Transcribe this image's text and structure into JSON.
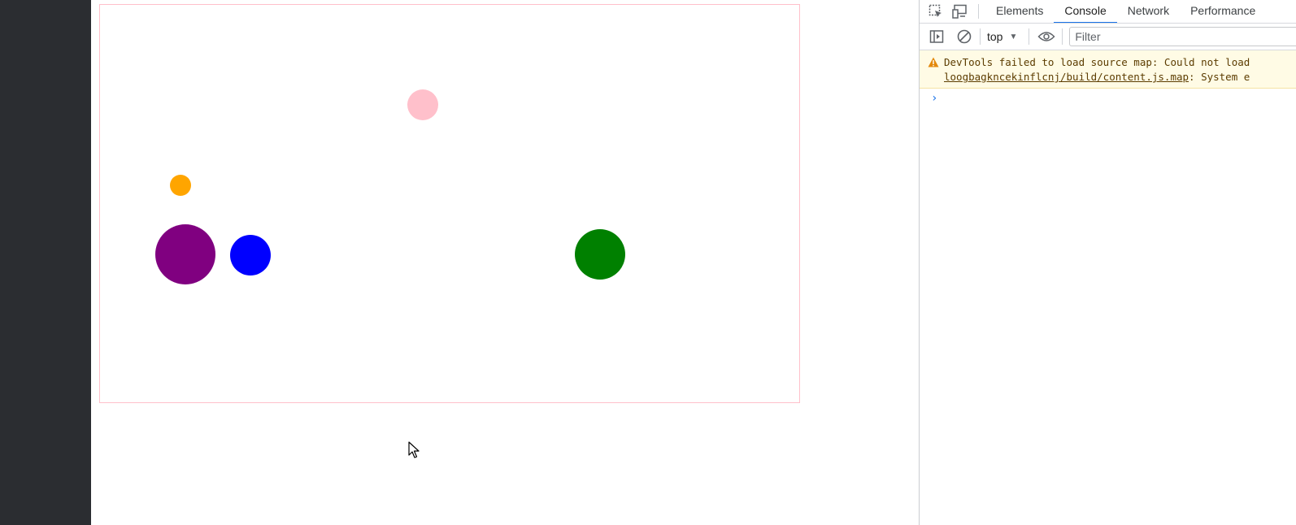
{
  "page": {
    "background": "#ffffff",
    "sidebar_color": "#2b2d31"
  },
  "canvas": {
    "border_color": "#ffc0cb",
    "balls": [
      {
        "name": "pink-ball",
        "color": "#ffc0cb"
      },
      {
        "name": "orange-ball",
        "color": "#ffa500"
      },
      {
        "name": "purple-ball",
        "color": "#800080"
      },
      {
        "name": "blue-ball",
        "color": "#0000ff"
      },
      {
        "name": "green-ball",
        "color": "#008000"
      }
    ]
  },
  "devtools": {
    "tabs": [
      {
        "label": "Elements",
        "active": false
      },
      {
        "label": "Console",
        "active": true
      },
      {
        "label": "Network",
        "active": false
      },
      {
        "label": "Performance",
        "active": false
      }
    ],
    "toolbar": {
      "context": "top",
      "filter_placeholder": "Filter"
    },
    "console": {
      "messages": [
        {
          "level": "warning",
          "line1": "DevTools failed to load source map: Could not load",
          "link": "loogbagkncekinflcnj/build/content.js.map",
          "line2_rest": ": System e"
        }
      ],
      "prompt": "›"
    },
    "accent_color": "#1a73e8"
  }
}
